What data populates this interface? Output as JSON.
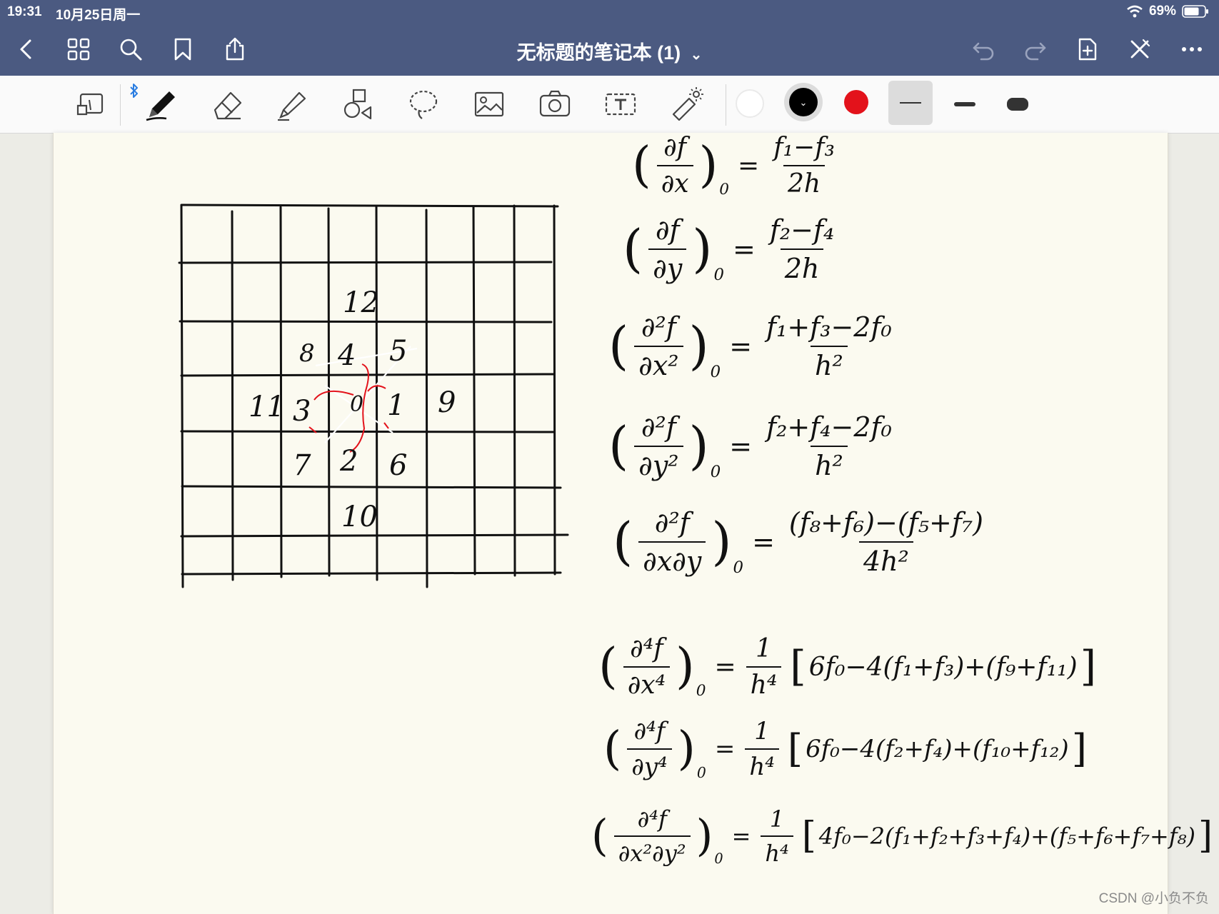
{
  "status": {
    "time": "19:31",
    "date": "10月25日周一",
    "battery": "69%"
  },
  "header": {
    "title": "无标题的笔记本 (1)"
  },
  "colors": {
    "topbar": "#4b5a81",
    "pen_selected": "#000000",
    "pen_red": "#e3121b",
    "ink": "#111111",
    "paper": "#fbfaf0"
  },
  "icons": [
    "back-chevron-icon",
    "grid-icon",
    "search-icon",
    "bookmark-icon",
    "share-icon",
    "undo-icon",
    "redo-icon",
    "add-page-icon",
    "close-pen-icon",
    "more-icon",
    "page-layout-icon",
    "bluetooth-icon",
    "pen-icon",
    "eraser-icon",
    "highlighter-icon",
    "shapes-icon",
    "lasso-icon",
    "image-icon",
    "camera-icon",
    "text-icon",
    "laser-pointer-icon"
  ],
  "grid_labels": [
    "12",
    "8",
    "4",
    "5",
    "11",
    "3",
    "0",
    "1",
    "9",
    "7",
    "2",
    "6",
    "10"
  ],
  "formulas": [
    {
      "lhs_num": "∂f",
      "lhs_den": "∂x",
      "lhs_sub": "0",
      "rhs_num": "f₁−f₃",
      "rhs_den": "2h"
    },
    {
      "lhs_num": "∂f",
      "lhs_den": "∂y",
      "lhs_sub": "0",
      "rhs_num": "f₂−f₄",
      "rhs_den": "2h"
    },
    {
      "lhs_num": "∂²f",
      "lhs_den": "∂x²",
      "lhs_sub": "0",
      "rhs_num": "f₁+f₃−2f₀",
      "rhs_den": "h²"
    },
    {
      "lhs_num": "∂²f",
      "lhs_den": "∂y²",
      "lhs_sub": "0",
      "rhs_num": "f₂+f₄−2f₀",
      "rhs_den": "h²"
    },
    {
      "lhs_num": "∂²f",
      "lhs_den": "∂x∂y",
      "lhs_sub": "0",
      "rhs_num": "(f₈+f₆)−(f₅+f₇)",
      "rhs_den": "4h²"
    },
    {
      "lhs_num": "∂⁴f",
      "lhs_den": "∂x⁴",
      "lhs_sub": "0",
      "coef_num": "1",
      "coef_den": "h⁴",
      "bracket": "6f₀−4(f₁+f₃)+(f₉+f₁₁)"
    },
    {
      "lhs_num": "∂⁴f",
      "lhs_den": "∂y⁴",
      "lhs_sub": "0",
      "coef_num": "1",
      "coef_den": "h⁴",
      "bracket": "6f₀−4(f₂+f₄)+(f₁₀+f₁₂)"
    },
    {
      "lhs_num": "∂⁴f",
      "lhs_den": "∂x²∂y²",
      "lhs_sub": "0",
      "coef_num": "1",
      "coef_den": "h⁴",
      "bracket": "4f₀−2(f₁+f₂+f₃+f₄)+(f₅+f₆+f₇+f₈)"
    }
  ],
  "watermark": "CSDN @小负不负"
}
